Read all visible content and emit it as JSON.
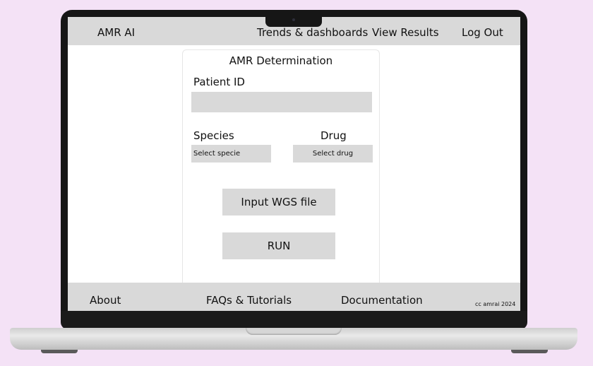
{
  "header": {
    "brand": "AMR AI",
    "nav": {
      "trends": "Trends & dashboards",
      "results": "View Results",
      "logout": "Log Out"
    }
  },
  "form": {
    "title": "AMR Determination",
    "patient_id_label": "Patient ID",
    "patient_id_value": "",
    "species_label": "Species",
    "species_select": "Select specie",
    "drug_label": "Drug",
    "drug_select": "Select drug",
    "upload_button": "Input WGS file",
    "run_button": "RUN"
  },
  "footer": {
    "about": "About",
    "faq": "FAQs & Tutorials",
    "docs": "Documentation",
    "copyright": "cc amrai 2024"
  },
  "colors": {
    "background": "#f4e2f6",
    "bar": "#d9d9d9",
    "laptop_frame": "#161616"
  }
}
